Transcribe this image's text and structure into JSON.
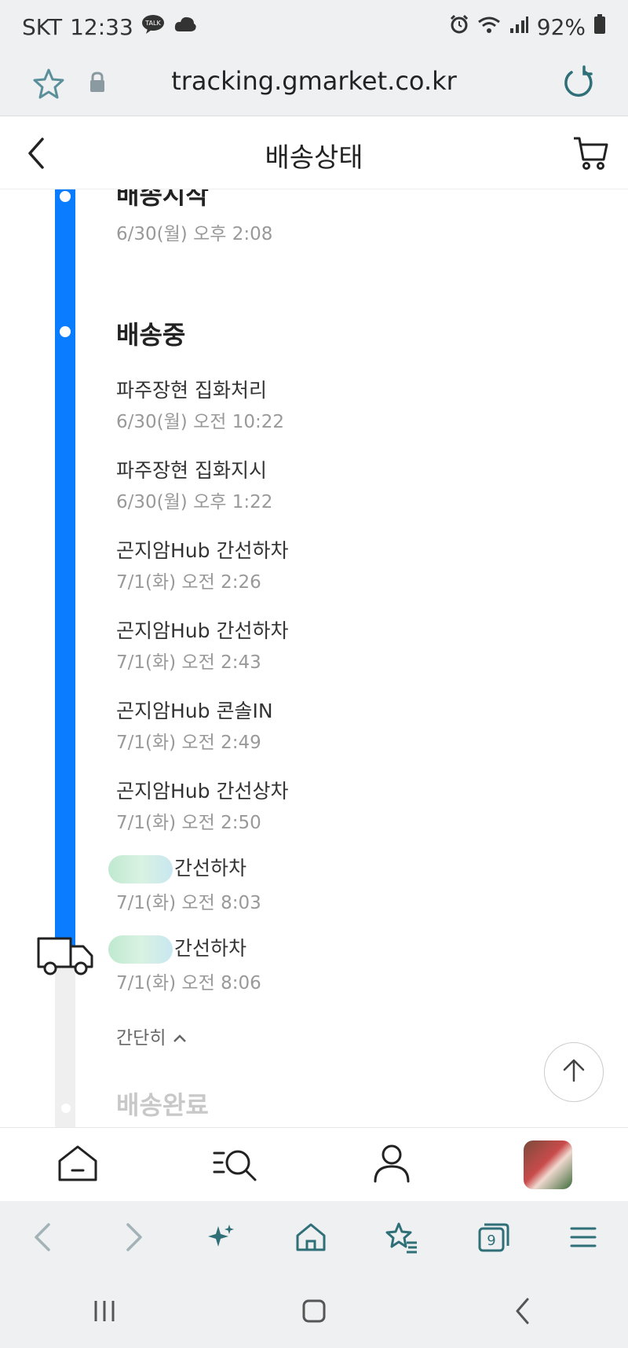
{
  "status_bar": {
    "carrier": "SKT",
    "time": "12:33",
    "battery": "92%",
    "icons": [
      "talk-icon",
      "cloud-icon",
      "alarm-icon",
      "wifi-icon",
      "signal-icon",
      "battery-icon"
    ]
  },
  "browser": {
    "url": "tracking.gmarket.co.kr"
  },
  "header": {
    "title": "배송상태"
  },
  "timeline": {
    "top_cut_title": "배송시작",
    "top_cut_time": "6/30(월) 오후 2:08",
    "in_transit_title": "배송중",
    "events": [
      {
        "name": "파주장현 집화처리",
        "time": "6/30(월) 오전 10:22"
      },
      {
        "name": "파주장현 집화지시",
        "time": "6/30(월) 오후 1:22"
      },
      {
        "name": "곤지암Hub 간선하차",
        "time": "7/1(화) 오전 2:26"
      },
      {
        "name": "곤지암Hub 간선하차",
        "time": "7/1(화) 오전 2:43"
      },
      {
        "name": "곤지암Hub 콘솔IN",
        "time": "7/1(화) 오전 2:49"
      },
      {
        "name": "곤지암Hub 간선상차",
        "time": "7/1(화) 오전 2:50"
      },
      {
        "name": "간선하차",
        "time": "7/1(화) 오전 8:03"
      },
      {
        "name": "간선하차",
        "time": "7/1(화) 오전 8:06"
      }
    ],
    "collapse_label": "간단히",
    "delivered_title": "배송완료"
  },
  "colors": {
    "accent": "#0a7cff",
    "rail_inactive": "#efefef"
  }
}
